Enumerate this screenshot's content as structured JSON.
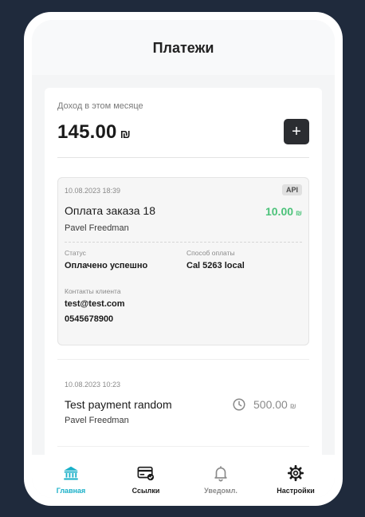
{
  "header": {
    "title": "Платежи"
  },
  "income": {
    "label": "Доход в этом месяце",
    "value": "145.00",
    "currency": "₪",
    "add_label": "+"
  },
  "payments": [
    {
      "date": "10.08.2023 18:39",
      "badge": "API",
      "title": "Оплата заказа 18",
      "amount": "10.00",
      "currency": "₪",
      "customer": "Pavel Freedman",
      "status_label": "Статус",
      "status_value": "Оплачено успешно",
      "method_label": "Способ оплаты",
      "method_value": "Cal 5263 local",
      "contacts_label": "Контакты клиента",
      "email": "test@test.com",
      "phone": "0545678900"
    },
    {
      "date": "10.08.2023 10:23",
      "title": "Test payment random",
      "amount": "500.00",
      "currency": "₪",
      "customer": "Pavel Freedman",
      "status_icon": "clock-icon"
    }
  ],
  "nav": {
    "items": [
      {
        "label": "Главная",
        "icon": "bank-icon",
        "active": true
      },
      {
        "label": "Ссылки",
        "icon": "card-link-icon"
      },
      {
        "label": "Уведомл.",
        "icon": "bell-icon"
      },
      {
        "label": "Настройки",
        "icon": "gear-icon"
      }
    ]
  },
  "colors": {
    "background": "#1f2a3c",
    "accent": "#1ab0c8",
    "success": "#4cc27a",
    "button_dark": "#2b2d31"
  }
}
